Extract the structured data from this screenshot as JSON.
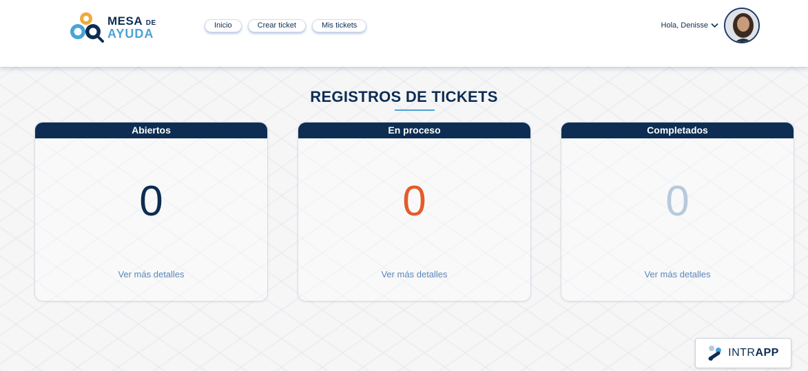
{
  "header": {
    "logo": {
      "line1": "MESA",
      "line1_small": "DE",
      "line2": "AYUDA"
    },
    "nav": [
      {
        "label": "Inicio"
      },
      {
        "label": "Crear ticket"
      },
      {
        "label": "Mis tickets"
      }
    ],
    "user": {
      "greeting": "Hola, Denisse",
      "chevron_icon": "chevron-down-icon",
      "avatar_icon": "user-avatar"
    }
  },
  "main": {
    "title": "REGISTROS DE TICKETS",
    "cards": [
      {
        "title": "Abiertos",
        "count": "0",
        "link": "Ver más detalles",
        "count_color": "#0d2d52"
      },
      {
        "title": "En proceso",
        "count": "0",
        "link": "Ver más detalles",
        "count_color": "#e35d2a"
      },
      {
        "title": "Completados",
        "count": "0",
        "link": "Ver más detalles",
        "count_color": "#b7cadb"
      }
    ]
  },
  "footer": {
    "brand_regular": "INTR",
    "brand_bold": "APP",
    "icon": "intrapp-logo-icon"
  },
  "colors": {
    "navy": "#0d2d52",
    "accent_blue": "#4aa3d8",
    "orange": "#e35d2a",
    "link_blue": "#5a86b8"
  }
}
